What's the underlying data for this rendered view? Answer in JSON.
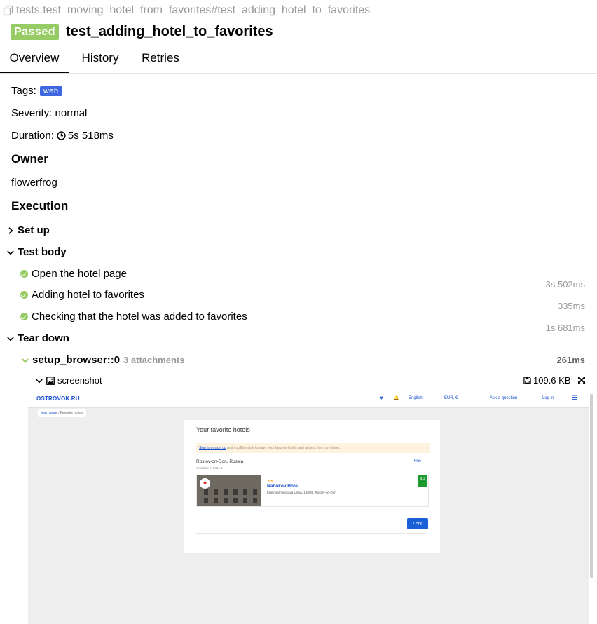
{
  "header": {
    "path": "tests.test_moving_hotel_from_favorites#test_adding_hotel_to_favorites",
    "status": "Passed",
    "title": "test_adding_hotel_to_favorites",
    "status_color": "#97cc64"
  },
  "tabs": [
    {
      "label": "Overview",
      "active": true
    },
    {
      "label": "History",
      "active": false
    },
    {
      "label": "Retries",
      "active": false
    }
  ],
  "overview": {
    "tags_label": "Tags:",
    "tag": "web",
    "severity": "Severity: normal",
    "duration_label": "Duration:",
    "duration_value": "5s 518ms",
    "owner_heading": "Owner",
    "owner": "flowerfrog",
    "execution_heading": "Execution"
  },
  "execution": {
    "setup": {
      "label": "Set up",
      "expanded": false
    },
    "body": {
      "label": "Test body",
      "expanded": true,
      "steps": [
        {
          "label": "Open the hotel page",
          "time": "3s 502ms"
        },
        {
          "label": "Adding hotel to favorites",
          "time": "335ms"
        },
        {
          "label": "Checking that the hotel was added to favorites",
          "time": "1s 681ms"
        }
      ]
    },
    "teardown": {
      "label": "Tear down",
      "expanded": true,
      "fixture": "setup_browser::0",
      "attachments": "3 attachments",
      "time": "261ms",
      "attachment": {
        "name": "screenshot",
        "size": "109.6 KB"
      }
    }
  },
  "screenshot": {
    "logo": "OSTROVOK.RU",
    "nav": [
      "English",
      "EUR, €",
      "Ask a question",
      "Log in"
    ],
    "breadcrumb": [
      "Main page",
      "›",
      "Favorite hotels"
    ],
    "heading": "Your favorite hotels",
    "notice_link": "Sign in or sign up",
    "notice_text": " and you'll be able to save your favorite hotels and access them any time...",
    "city": "Rostov-on-Don, Russia",
    "available": "Available in total: 1",
    "hide": "Hide",
    "stars": "★★",
    "hotel_name": "Nabokov Hotel",
    "address": "Krasnoarmejskaya Ulitsa, 168/99, Rostov-on-Don",
    "score": "9.1",
    "copy_button": "Copy"
  }
}
